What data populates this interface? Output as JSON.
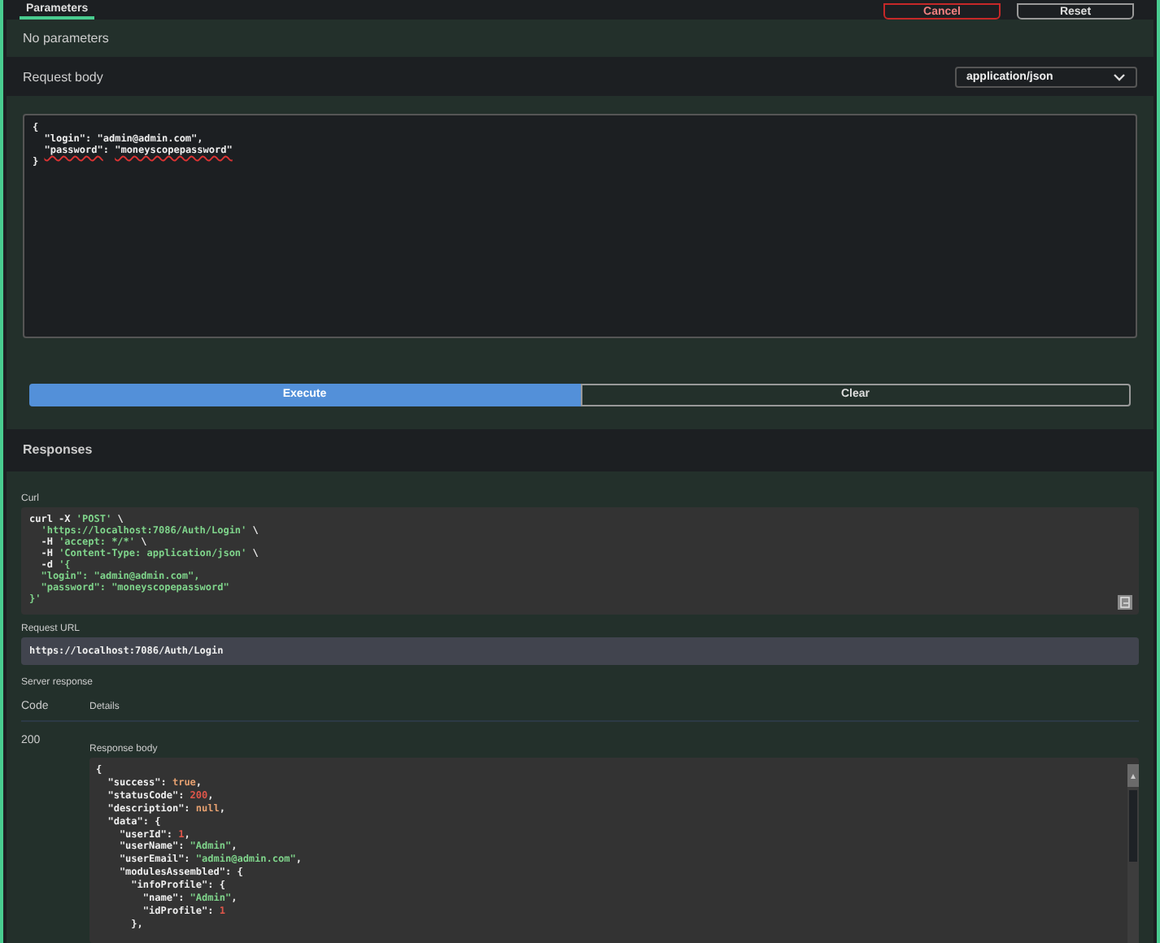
{
  "tabs": [
    {
      "label": "Parameters",
      "selected": true
    }
  ],
  "header_buttons": [
    {
      "label": "Cancel",
      "kind": "danger"
    },
    {
      "label": "Reset",
      "kind": "plain"
    }
  ],
  "parameters": {
    "text": "No parameters"
  },
  "request_body": {
    "label": "Request body",
    "content_type": "application/json",
    "lines": [
      [
        {
          "t": "{",
          "kind": "plain"
        }
      ],
      [
        {
          "t": "  \"login\": \"admin@admin.com\",",
          "kind": "plain"
        }
      ],
      [
        {
          "t": "  \"password\"",
          "kind": "flagged"
        },
        {
          "t": ": ",
          "kind": "plain"
        },
        {
          "t": "\"moneyscopepassword\"",
          "kind": "flagged"
        }
      ],
      [
        {
          "t": "}",
          "kind": "plain"
        }
      ]
    ]
  },
  "actions": [
    {
      "label": "Execute",
      "kind": "primary"
    },
    {
      "label": "Clear",
      "kind": "secondary"
    }
  ],
  "responses": {
    "title": "Responses",
    "curl": {
      "label": "Curl",
      "lines": [
        [
          {
            "t": "curl -X ",
            "kind": "plain"
          },
          {
            "t": "'POST'",
            "kind": "str"
          },
          {
            "t": " \\",
            "kind": "plain"
          }
        ],
        [
          {
            "t": "  'https://localhost:7086/Auth/Login'",
            "kind": "str"
          },
          {
            "t": " \\",
            "kind": "plain"
          }
        ],
        [
          {
            "t": "  -H ",
            "kind": "plain"
          },
          {
            "t": "'accept: */*'",
            "kind": "str"
          },
          {
            "t": " \\",
            "kind": "plain"
          }
        ],
        [
          {
            "t": "  -H ",
            "kind": "plain"
          },
          {
            "t": "'Content-Type: application/json'",
            "kind": "str"
          },
          {
            "t": " \\",
            "kind": "plain"
          }
        ],
        [
          {
            "t": "  -d ",
            "kind": "plain"
          },
          {
            "t": "'{",
            "kind": "str"
          }
        ],
        [
          {
            "t": "  \"login\": \"admin@admin.com\",",
            "kind": "str"
          }
        ],
        [
          {
            "t": "  \"password\": \"moneyscopepassword\"",
            "kind": "str"
          }
        ],
        [
          {
            "t": "}'",
            "kind": "str"
          }
        ]
      ]
    },
    "request_url": {
      "label": "Request URL",
      "value": "https://localhost:7086/Auth/Login"
    },
    "server_response": {
      "label": "Server response",
      "columns": [
        "Code",
        "Details"
      ],
      "rows": [
        {
          "code": "200",
          "body_label": "Response body",
          "lines": [
            [
              {
                "t": "{",
                "kind": "plain"
              }
            ],
            [
              {
                "t": "  \"success\": ",
                "kind": "plain"
              },
              {
                "t": "true",
                "kind": "bool"
              },
              {
                "t": ",",
                "kind": "plain"
              }
            ],
            [
              {
                "t": "  \"statusCode\": ",
                "kind": "plain"
              },
              {
                "t": "200",
                "kind": "num"
              },
              {
                "t": ",",
                "kind": "plain"
              }
            ],
            [
              {
                "t": "  \"description\": ",
                "kind": "plain"
              },
              {
                "t": "null",
                "kind": "bool"
              },
              {
                "t": ",",
                "kind": "plain"
              }
            ],
            [
              {
                "t": "  \"data\": {",
                "kind": "plain"
              }
            ],
            [
              {
                "t": "    \"userId\": ",
                "kind": "plain"
              },
              {
                "t": "1",
                "kind": "num"
              },
              {
                "t": ",",
                "kind": "plain"
              }
            ],
            [
              {
                "t": "    \"userName\": ",
                "kind": "plain"
              },
              {
                "t": "\"Admin\"",
                "kind": "str"
              },
              {
                "t": ",",
                "kind": "plain"
              }
            ],
            [
              {
                "t": "    \"userEmail\": ",
                "kind": "plain"
              },
              {
                "t": "\"admin@admin.com\"",
                "kind": "str"
              },
              {
                "t": ",",
                "kind": "plain"
              }
            ],
            [
              {
                "t": "    \"modulesAssembled\": {",
                "kind": "plain"
              }
            ],
            [
              {
                "t": "      \"infoProfile\": {",
                "kind": "plain"
              }
            ],
            [
              {
                "t": "        \"name\": ",
                "kind": "plain"
              },
              {
                "t": "\"Admin\"",
                "kind": "str"
              },
              {
                "t": ",",
                "kind": "plain"
              }
            ],
            [
              {
                "t": "        \"idProfile\": ",
                "kind": "plain"
              },
              {
                "t": "1",
                "kind": "num"
              }
            ],
            [
              {
                "t": "      },",
                "kind": "plain"
              }
            ]
          ]
        }
      ]
    }
  }
}
